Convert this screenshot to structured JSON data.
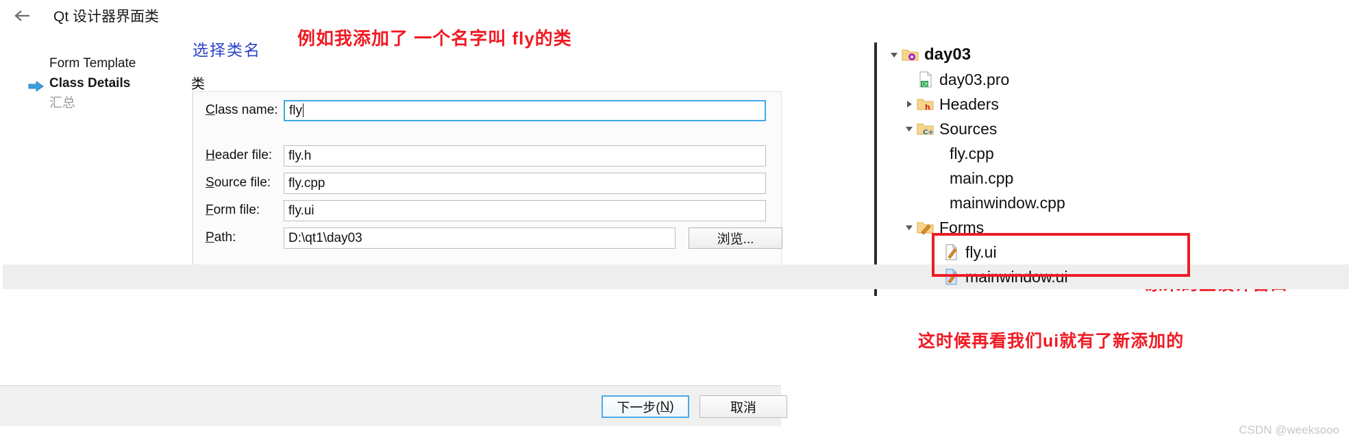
{
  "dialog": {
    "title": "Qt 设计器界面类",
    "back_icon": "back-arrow-icon",
    "steps": [
      {
        "label": "Form Template",
        "state": "done"
      },
      {
        "label": "Class Details",
        "state": "current"
      },
      {
        "label": "汇总",
        "state": "future"
      }
    ],
    "group_label": "类",
    "fields": [
      {
        "name": "class-name",
        "label_pre": "C",
        "label_post": "lass name:",
        "value": "fly",
        "focused": true
      },
      {
        "name": "header-file",
        "label_pre": "H",
        "label_post": "eader file:",
        "value": "fly.h",
        "focused": false
      },
      {
        "name": "source-file",
        "label_pre": "S",
        "label_post": "ource file:",
        "value": "fly.cpp",
        "focused": false
      },
      {
        "name": "form-file",
        "label_pre": "F",
        "label_post": "orm file:",
        "value": "fly.ui",
        "focused": false
      },
      {
        "name": "path",
        "label_pre": "P",
        "label_post": "ath:",
        "value": "D:\\qt1\\day03",
        "focused": false
      }
    ],
    "browse_label": "浏览...",
    "buttons": {
      "next_pre": "下一步(",
      "next_key": "N",
      "next_post": ")",
      "cancel": "取消"
    }
  },
  "annotations": {
    "blue_select_class": "选择类名",
    "top_red": "例如我添加了 一个名字叫 fly的类",
    "right_red": "原来的主设计窗口",
    "bottom_red": "这时候再看我们ui就有了新添加的",
    "blue_color": "#2c43c9",
    "red_color": "#f01a23"
  },
  "tree": {
    "items": [
      {
        "label": "day03",
        "indent": 0,
        "twisty": "down",
        "icon": "project-folder-icon",
        "bold": true,
        "selected": false
      },
      {
        "label": "day03.pro",
        "indent": 1,
        "twisty": "none",
        "icon": "qt-pro-file-icon",
        "bold": false,
        "selected": false
      },
      {
        "label": "Headers",
        "indent": 1,
        "twisty": "right",
        "icon": "headers-folder-icon",
        "bold": false,
        "selected": false
      },
      {
        "label": "Sources",
        "indent": 1,
        "twisty": "down",
        "icon": "sources-folder-icon",
        "bold": false,
        "selected": false
      },
      {
        "label": "fly.cpp",
        "indent": 2,
        "twisty": "none",
        "icon": "none",
        "bold": false,
        "selected": false
      },
      {
        "label": "main.cpp",
        "indent": 2,
        "twisty": "none",
        "icon": "none",
        "bold": false,
        "selected": false
      },
      {
        "label": "mainwindow.cpp",
        "indent": 2,
        "twisty": "none",
        "icon": "none",
        "bold": false,
        "selected": false
      },
      {
        "label": "Forms",
        "indent": 1,
        "twisty": "down",
        "icon": "forms-folder-icon",
        "bold": false,
        "selected": false
      },
      {
        "label": "fly.ui",
        "indent": 2,
        "twisty": "none",
        "icon": "ui-file-icon",
        "bold": false,
        "selected": false
      },
      {
        "label": "mainwindow.ui",
        "indent": 2,
        "twisty": "none",
        "icon": "ui-file-blue-icon",
        "bold": false,
        "selected": true
      }
    ]
  },
  "watermark": "CSDN @weeksooo"
}
